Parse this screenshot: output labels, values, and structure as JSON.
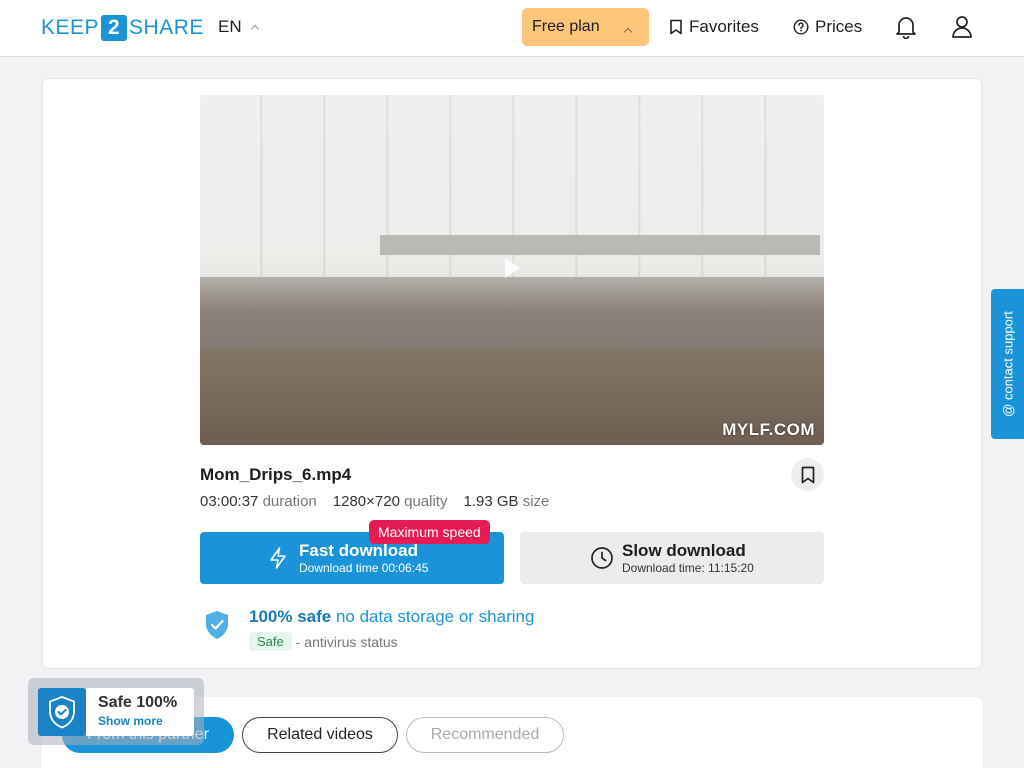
{
  "header": {
    "logo_left": "KEEP",
    "logo_mid": "2",
    "logo_right": "SHARE",
    "language": "EN",
    "plan_label": "Free plan",
    "favorites_label": "Favorites",
    "prices_label": "Prices"
  },
  "video": {
    "watermark": "MYLF.COM"
  },
  "file": {
    "name": "Mom_Drips_6.mp4",
    "duration_value": "03:00:37",
    "duration_label": "duration",
    "quality_value": "1280×720",
    "quality_label": "quality",
    "size_value": "1.93 GB",
    "size_label": "size"
  },
  "download": {
    "fast_label": "Fast download",
    "fast_time": "Download time 00:06:45",
    "max_speed_badge": "Maximum speed",
    "slow_label": "Slow download",
    "slow_time": "Download time: 11:15:20"
  },
  "safety": {
    "headline_strong": "100% safe",
    "headline_light": "no data storage or sharing",
    "av_pill": "Safe",
    "av_text": "- antivirus status"
  },
  "support": {
    "label": "@ contact support"
  },
  "tabs": [
    {
      "label": "From this partner"
    },
    {
      "label": "Related videos"
    },
    {
      "label": "Recommended"
    }
  ],
  "safe_widget": {
    "title": "Safe 100%",
    "link": "Show more"
  },
  "colors": {
    "brand": "#1a93d8",
    "plan_bg": "#fbc57a",
    "badge": "#e41c53"
  }
}
